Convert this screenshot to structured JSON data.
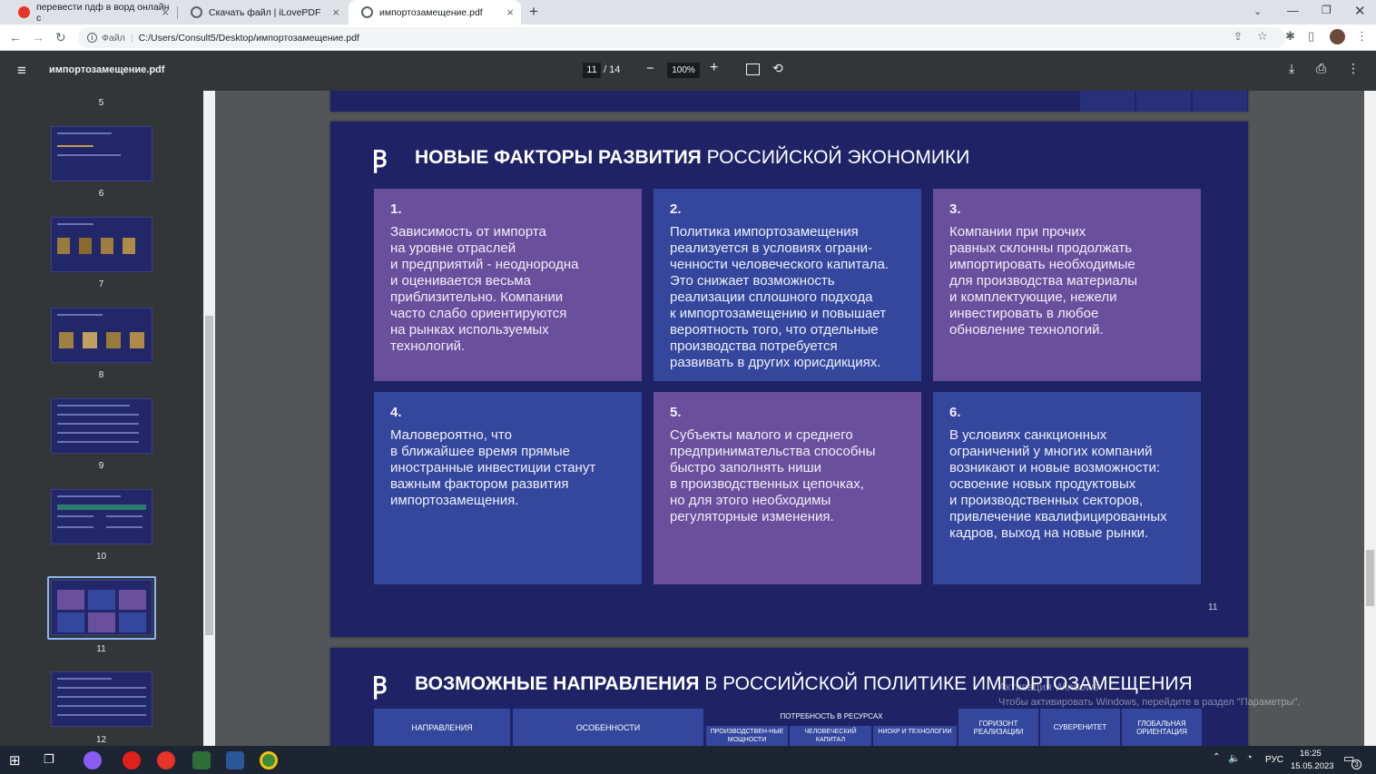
{
  "browser": {
    "tabs": [
      {
        "title": "перевести пдф в ворд онлайн с",
        "color": "#e8332a"
      },
      {
        "title": "Скачать файл | iLovePDF",
        "color": "#5f6368"
      },
      {
        "title": "импортозамещение.pdf",
        "color": "#5f6368"
      }
    ],
    "new_tab": "+",
    "address_scheme": "Файл",
    "address_url": "C:/Users/Consult5/Desktop/импортозамещение.pdf"
  },
  "pdf_toolbar": {
    "filename": "импортозамещение.pdf",
    "current_page": "11",
    "page_total": "/ 14",
    "zoom": "100%"
  },
  "sidebar": {
    "pages": [
      "5",
      "6",
      "7",
      "8",
      "9",
      "10",
      "11",
      "12"
    ],
    "selected": "11"
  },
  "page11": {
    "title_bold": "НОВЫЕ ФАКТОРЫ РАЗВИТИЯ",
    "title_rest": "РОССИЙСКОЙ ЭКОНОМИКИ",
    "page_number": "11",
    "cards": [
      {
        "num": "1.",
        "text": "Зависимость от импорта\nна уровне отраслей\nи предприятий - неоднородна\nи оценивается весьма\nприблизительно. Компании\nчасто слабо ориентируются\nна рынках используемых\nтехнологий.",
        "style": "purple"
      },
      {
        "num": "2.",
        "text": "Политика импортозамещения\nреализуется в условиях ограни-\nченности человеческого капитала.\nЭто снижает возможность\nреализации сплошного подхода\nк импортозамещению и повышает\nвероятность того, что отдельные\nпроизводства потребуется\nразвивать в других юрисдикциях.",
        "style": "blue"
      },
      {
        "num": "3.",
        "text": "Компании при прочих\nравных склонны продолжать\nимпортировать необходимые\nдля производства материалы\nи комплектующие, нежели\nинвестировать в любое\nобновление технологий.",
        "style": "purple"
      },
      {
        "num": "4.",
        "text": "Маловероятно, что\nв ближайшее время прямые\nиностранные инвестиции станут\nважным фактором развития\nимпортозамещения.",
        "style": "blue"
      },
      {
        "num": "5.",
        "text": "Субъекты малого и среднего\nпредпринимательства способны\nбыстро заполнять ниши\nв производственных цепочках,\nно для этого необходимы\nрегуляторные изменения.",
        "style": "purple"
      },
      {
        "num": "6.",
        "text": "В условиях санкционных\nограничений у многих компаний\nвозникают и новые возможности:\nосвоение новых продуктовых\nи производственных секторов,\nпривлечение квалифицированных\nкадров, выход на новые рынки.",
        "style": "blue"
      }
    ]
  },
  "page12": {
    "title_bold": "ВОЗМОЖНЫЕ НАПРАВЛЕНИЯ",
    "title_rest": "В РОССИЙСКОЙ ПОЛИТИКЕ ИМПОРТОЗАМЕЩЕНИЯ",
    "headers": {
      "directions": "НАПРАВЛЕНИЯ",
      "features": "ОСОБЕННОСТИ",
      "resources": "ПОТРЕБНОСТЬ В РЕСУРСАХ",
      "capacity": "ПРОИЗВОДСТВЕН-НЫЕ МОЩНОСТИ",
      "human": "ЧЕЛОВЕЧЕСКИЙ КАПИТАЛ",
      "rnd": "НИОКР И ТЕХНОЛОГИИ",
      "horizon": "ГОРИЗОНТ РЕАЛИЗАЦИИ",
      "sovereignty": "СУВЕРЕНИТЕТ",
      "global": "ГЛОБАЛЬНАЯ ОРИЕНТАЦИЯ"
    }
  },
  "watermark": {
    "line1": "Активация Windows",
    "line2": "Чтобы активировать Windows, перейдите в раздел \"Параметры\"."
  },
  "taskbar": {
    "lang": "РУС",
    "time": "16:25",
    "date": "15.05.2023",
    "notifications": "3"
  }
}
